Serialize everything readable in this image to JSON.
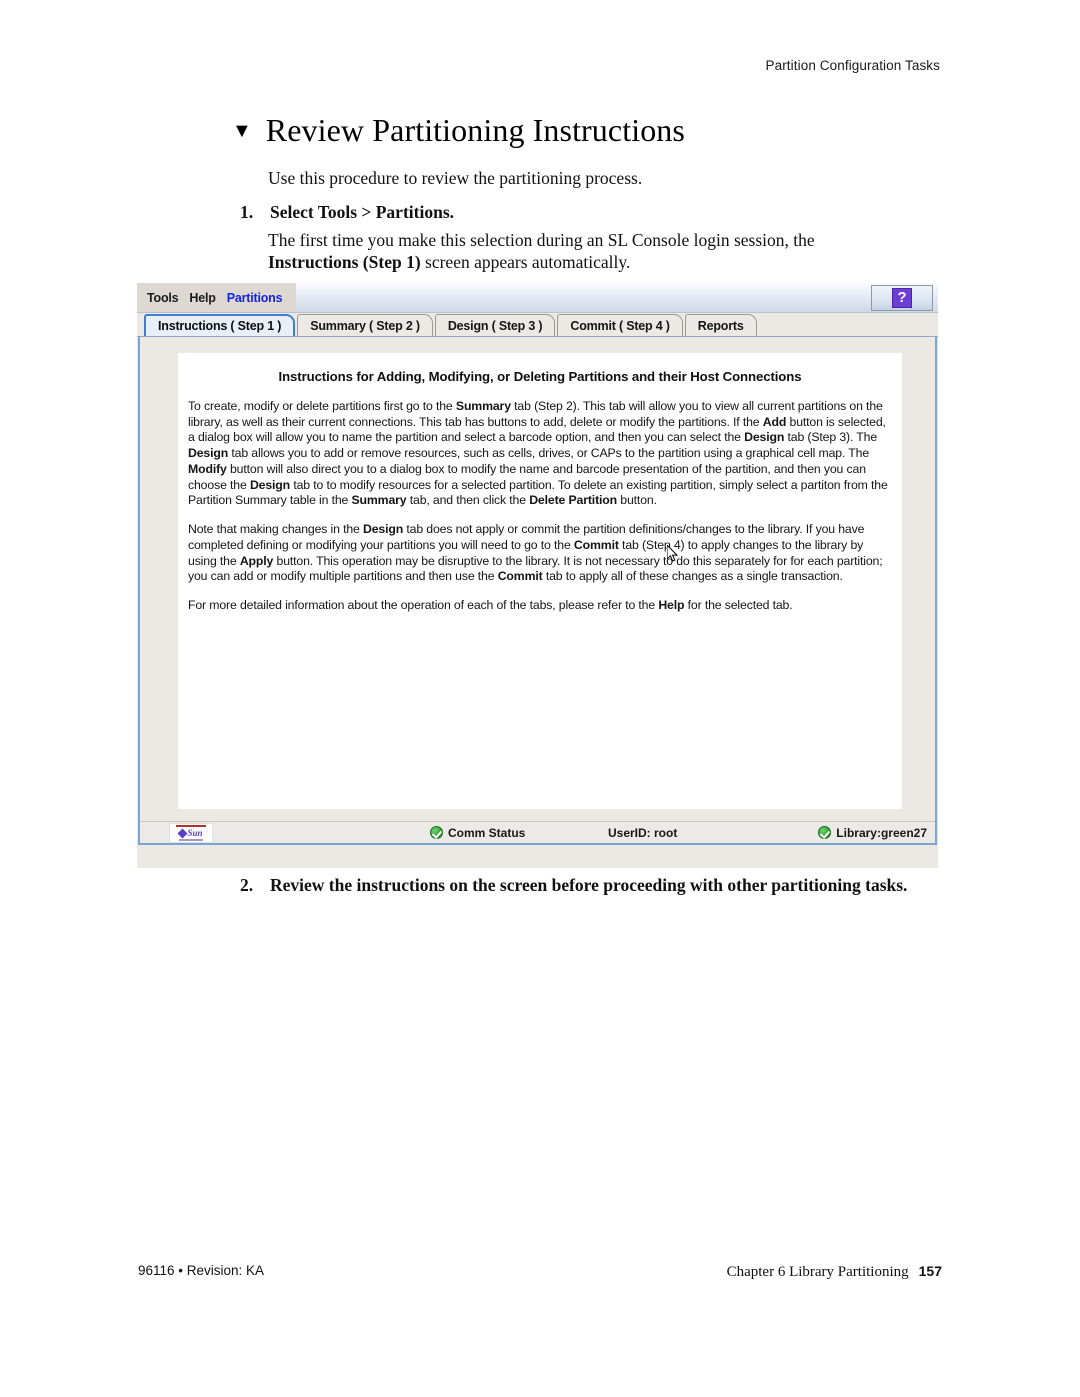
{
  "page": {
    "running_head": "Partition Configuration Tasks",
    "heading_marker": "▼",
    "heading": "Review Partitioning Instructions",
    "intro": "Use this procedure to review the partitioning process.",
    "steps": [
      {
        "number": "1.",
        "title": "Select Tools > Partitions.",
        "body_prefix": "The first time you make this selection during an SL Console login session, the ",
        "body_bold": "Instructions (Step 1)",
        "body_suffix": " screen appears automatically."
      },
      {
        "number": "2.",
        "title": "Review the instructions on the screen before proceeding with other partitioning tasks."
      }
    ],
    "footer": {
      "left": "96116 • Revision: KA",
      "chapter": "Chapter 6 Library Partitioning",
      "page_number": "157"
    }
  },
  "app": {
    "menu": {
      "items": [
        {
          "label": "Tools",
          "accent": false
        },
        {
          "label": "Help",
          "accent": false
        },
        {
          "label": "Partitions",
          "accent": true
        }
      ],
      "help_button_glyph": "?",
      "accent_color": "#1423e8"
    },
    "tabs": [
      {
        "label": "Instructions ( Step 1 )",
        "active": true
      },
      {
        "label": "Summary ( Step 2 )",
        "active": false
      },
      {
        "label": "Design ( Step 3 )",
        "active": false
      },
      {
        "label": "Commit ( Step 4 )",
        "active": false
      },
      {
        "label": "Reports",
        "active": false
      }
    ],
    "panel": {
      "title": "Instructions for Adding, Modifying, or Deleting Partitions and their Host Connections",
      "paragraphs": [
        [
          {
            "t": "To create, modify or delete partitions first go to the ",
            "b": false
          },
          {
            "t": "Summary",
            "b": true
          },
          {
            "t": " tab (Step 2). This tab will allow you to view all current partitions on the library, as well as their current connections. This tab has buttons to add, delete or modify the partitions. If the ",
            "b": false
          },
          {
            "t": "Add",
            "b": true
          },
          {
            "t": " button is selected, a dialog box will allow you to name the partition and select a barcode option, and then you can select the ",
            "b": false
          },
          {
            "t": "Design",
            "b": true
          },
          {
            "t": " tab (Step 3). The ",
            "b": false
          },
          {
            "t": "Design",
            "b": true
          },
          {
            "t": " tab allows you to add or remove resources, such as cells, drives, or CAPs to the partition using a graphical cell map. The ",
            "b": false
          },
          {
            "t": "Modify",
            "b": true
          },
          {
            "t": " button will also direct you to a dialog box to modify the name and barcode presentation of the partition, and then you can choose the ",
            "b": false
          },
          {
            "t": "Design",
            "b": true
          },
          {
            "t": " tab to to modify resources for a selected partition. To delete an existing partition, simply select a partiton from the Partition Summary table in the ",
            "b": false
          },
          {
            "t": "Summary",
            "b": true
          },
          {
            "t": " tab, and then click the ",
            "b": false
          },
          {
            "t": "Delete Partition",
            "b": true
          },
          {
            "t": " button.",
            "b": false
          }
        ],
        [
          {
            "t": "Note that making changes in the ",
            "b": false
          },
          {
            "t": "Design",
            "b": true
          },
          {
            "t": " tab does not apply or commit the partition definitions/changes to the library. If you have completed defining or modifying your partitions you will need to go to the ",
            "b": false
          },
          {
            "t": "Commit",
            "b": true
          },
          {
            "t": " tab (Step 4) to apply changes to the library by using the ",
            "b": false
          },
          {
            "t": "Apply",
            "b": true
          },
          {
            "t": " button. This operation may be disruptive to the library. It is not necessary to do this separately for for each partition; you can add or modify multiple partitions and then use the ",
            "b": false
          },
          {
            "t": "Commit",
            "b": true
          },
          {
            "t": " tab to apply all of these changes as a single transaction.",
            "b": false
          }
        ],
        [
          {
            "t": "For more detailed information about the operation of each of the tabs, please refer to the ",
            "b": false
          },
          {
            "t": "Help",
            "b": true
          },
          {
            "t": " for the selected tab.",
            "b": false
          }
        ]
      ]
    },
    "status_bar": {
      "logo_text": "Sun",
      "comm_status": "Comm Status",
      "user_id": "UserID: root",
      "library": "Library:green27",
      "ok_color": "#2e9b2e"
    }
  }
}
